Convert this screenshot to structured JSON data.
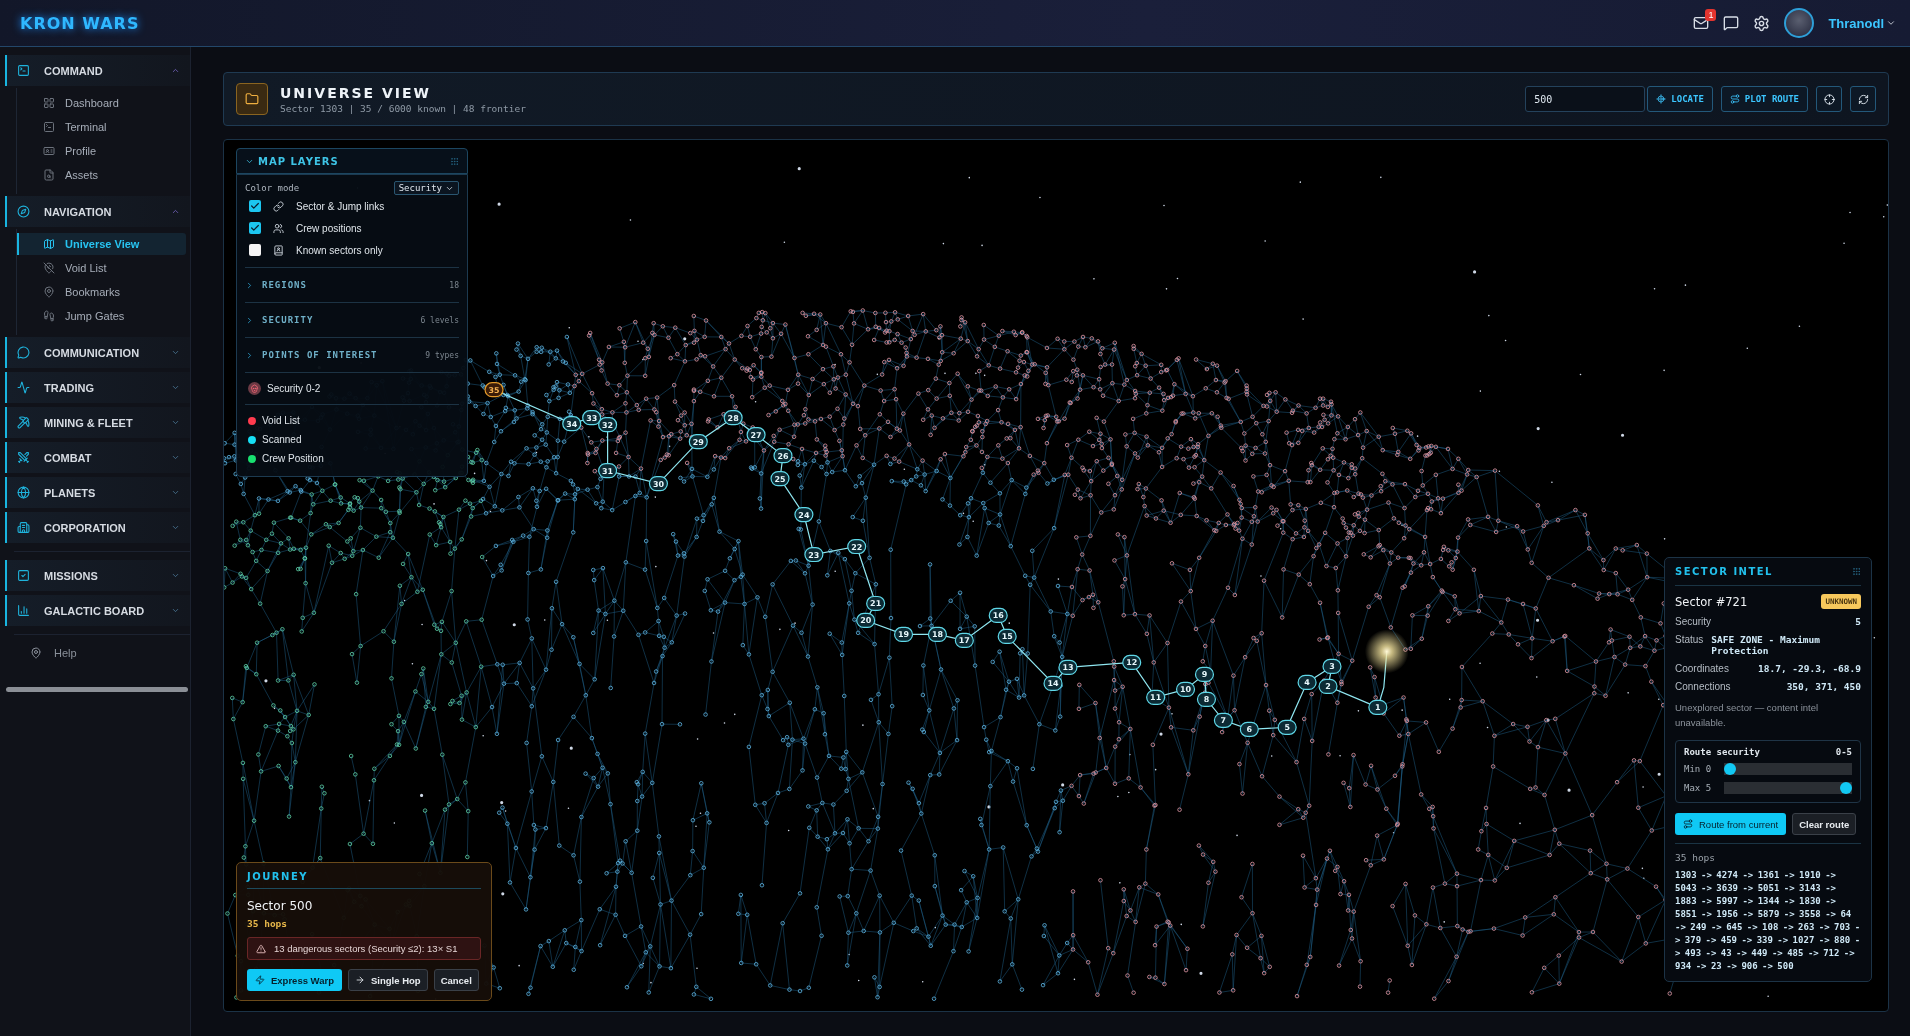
{
  "app": {
    "logo": "KRON WARS"
  },
  "topbar": {
    "mail_badge": "1",
    "user": "Thranodl"
  },
  "sidebar": {
    "section_groups": [
      [
        {
          "label": "COMMAND",
          "expanded": true,
          "items": [
            {
              "label": "Dashboard",
              "selected": false
            },
            {
              "label": "Terminal",
              "selected": false
            },
            {
              "label": "Profile",
              "selected": false
            },
            {
              "label": "Assets",
              "selected": false
            }
          ]
        },
        {
          "label": "NAVIGATION",
          "expanded": true,
          "items": [
            {
              "label": "Universe View",
              "selected": true
            },
            {
              "label": "Void List",
              "selected": false
            },
            {
              "label": "Bookmarks",
              "selected": false
            },
            {
              "label": "Jump Gates",
              "selected": false
            }
          ]
        },
        {
          "label": "COMMUNICATION",
          "expanded": false
        },
        {
          "label": "TRADING",
          "expanded": false
        },
        {
          "label": "MINING & FLEET",
          "expanded": false
        },
        {
          "label": "COMBAT",
          "expanded": false
        },
        {
          "label": "PLANETS",
          "expanded": false
        },
        {
          "label": "CORPORATION",
          "expanded": false
        }
      ],
      [
        {
          "label": "MISSIONS",
          "expanded": false
        },
        {
          "label": "GALACTIC BOARD",
          "expanded": false
        }
      ]
    ],
    "help": "Help"
  },
  "header": {
    "title": "UNIVERSE VIEW",
    "subtitle": "Sector 1303 | 35 / 6000 known | 48 frontier",
    "search": {
      "value": "500"
    },
    "buttons": [
      "LOCATE",
      "PLOT ROUTE"
    ]
  },
  "map_layers": {
    "title": "MAP LAYERS",
    "expanded": true,
    "color_mode_label": "Color mode",
    "color_mode": "Security",
    "toggles": [
      {
        "label": "Sector & Jump links",
        "checked": true
      },
      {
        "label": "Crew positions",
        "checked": true
      },
      {
        "label": "Known sectors only",
        "checked": false
      }
    ],
    "groups": [
      {
        "label": "REGIONS",
        "count": "18"
      },
      {
        "label": "SECURITY",
        "count": "6 levels"
      },
      {
        "label": "POINTS OF INTEREST",
        "count": "9 types"
      }
    ],
    "security_filter": "Security 0-2",
    "legend": [
      {
        "label": "Void List",
        "color": "#ff3b4e"
      },
      {
        "label": "Scanned",
        "color": "#16e0f5"
      },
      {
        "label": "Crew Position",
        "color": "#18e070"
      }
    ]
  },
  "route": {
    "nodes": [
      {
        "label": "35",
        "kind": "destination"
      },
      {
        "label": "34",
        "kind": "hop"
      },
      {
        "label": "33",
        "kind": "hop"
      },
      {
        "label": "32",
        "kind": "hop"
      },
      {
        "label": "31",
        "kind": "hop"
      },
      {
        "label": "30",
        "kind": "hop"
      },
      {
        "label": "29",
        "kind": "hop"
      },
      {
        "label": "28",
        "kind": "hop"
      },
      {
        "label": "27",
        "kind": "hop"
      },
      {
        "label": "26",
        "kind": "hop"
      },
      {
        "label": "25",
        "kind": "hop"
      },
      {
        "label": "24",
        "kind": "hop"
      },
      {
        "label": "23",
        "kind": "hop"
      },
      {
        "label": "22",
        "kind": "hop"
      },
      {
        "label": "21",
        "kind": "hop"
      },
      {
        "label": "20",
        "kind": "hop"
      },
      {
        "label": "19",
        "kind": "hop"
      },
      {
        "label": "18",
        "kind": "hop"
      },
      {
        "label": "17",
        "kind": "hop"
      },
      {
        "label": "16",
        "kind": "hop"
      },
      {
        "label": "15",
        "kind": "hop"
      },
      {
        "label": "14",
        "kind": "hop"
      },
      {
        "label": "13",
        "kind": "hop"
      },
      {
        "label": "12",
        "kind": "hop"
      },
      {
        "label": "11",
        "kind": "hop"
      },
      {
        "label": "10",
        "kind": "hop"
      },
      {
        "label": "9",
        "kind": "hop"
      },
      {
        "label": "8",
        "kind": "hop"
      },
      {
        "label": "7",
        "kind": "hop"
      },
      {
        "label": "6",
        "kind": "hop"
      },
      {
        "label": "5",
        "kind": "hop"
      },
      {
        "label": "4",
        "kind": "hop"
      },
      {
        "label": "3",
        "kind": "hop"
      },
      {
        "label": "2",
        "kind": "hop"
      },
      {
        "label": "1",
        "kind": "hop"
      }
    ]
  },
  "sector_intel": {
    "title": "SECTOR INTEL",
    "sector": "Sector #721",
    "badge": "UNKNOWN",
    "rows": [
      {
        "label": "Security",
        "value": "5"
      },
      {
        "label": "Status",
        "value": "SAFE ZONE - Maximum Protection"
      },
      {
        "label": "Coordinates",
        "value": "18.7, -29.3, -68.9"
      },
      {
        "label": "Connections",
        "value": "350, 371, 450"
      }
    ],
    "note": "Unexplored sector — content intel unavailable.",
    "route_security": {
      "label": "Route security",
      "range": "0-5",
      "sliders": [
        {
          "label": "Min 0",
          "level": 0
        },
        {
          "label": "Max 5",
          "level": 1
        }
      ]
    },
    "buttons": [
      "Route from current",
      "Clear route"
    ],
    "hops": "35 hops",
    "path": "1303 -> 4274 -> 1361 -> 1910 -> 5043 -> 3639 -> 5051 -> 3143 -> 1883 -> 5997 -> 1344 -> 1830 -> 5851 -> 1956 -> 5879 -> 3558 -> 64 -> 249 -> 645 -> 108 -> 263 -> 703 -> 379 -> 459 -> 339 -> 1027 -> 880 -> 493 -> 43 -> 449 -> 485 -> 712 -> 934 -> 23 -> 906 -> 500"
  },
  "journey": {
    "title": "JOURNEY",
    "sector": "Sector 500",
    "hops": "35 hops",
    "warning": "13 dangerous sectors (Security ≤2): 13× S1",
    "buttons": [
      "Express Warp",
      "Single Hop",
      "Cancel"
    ]
  }
}
